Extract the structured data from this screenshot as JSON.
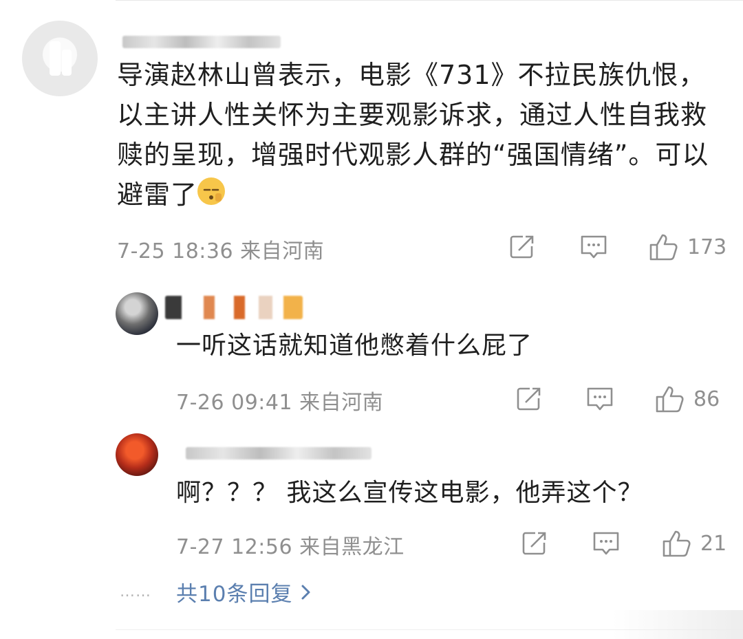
{
  "main_comment": {
    "text": "导演赵林山曾表示，电影《731》不拉民族仇恨，以主讲人性关怀为主要观影诉求，通过人性自我救赎的呈现，增强时代观影人群的“强国情绪”。可以避雷了",
    "meta": "7-25 18:36 来自河南",
    "likes": "173"
  },
  "replies": [
    {
      "text": "一听这话就知道他憋着什么屁了",
      "meta": "7-26 09:41 来自河南",
      "likes": "86"
    },
    {
      "text": "啊？？？ 我这么宣传这电影，他弄这个？",
      "meta": "7-27 12:56 来自黑龙江",
      "likes": "21"
    }
  ],
  "more_replies": {
    "dots": "……",
    "label": "共10条回复"
  },
  "colors": {
    "link": "#5b7faf",
    "meta": "#8f8f8f",
    "text": "#1f1f1f"
  },
  "icons": [
    "share-icon",
    "comment-icon",
    "like-icon",
    "chevron-right-icon",
    "emoji-icon"
  ]
}
